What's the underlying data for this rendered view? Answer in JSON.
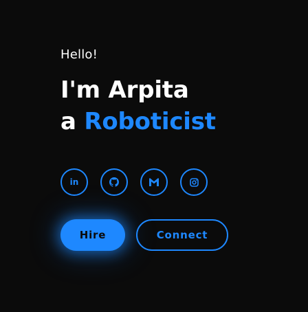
{
  "hero": {
    "greeting": "Hello!",
    "line1": "I'm Arpita",
    "line2_prefix": "a ",
    "line2_accent": "Roboticist"
  },
  "socials": [
    {
      "icon": "linkedin-icon",
      "label": "in"
    },
    {
      "icon": "github-icon"
    },
    {
      "icon": "gmail-icon"
    },
    {
      "icon": "instagram-icon"
    }
  ],
  "actions": {
    "hire_label": "Hire",
    "connect_label": "Connect"
  },
  "colors": {
    "background": "#0b0b0b",
    "accent": "#1e88ff",
    "text": "#ffffff"
  }
}
